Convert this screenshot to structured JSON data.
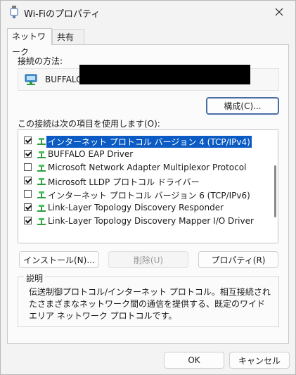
{
  "window": {
    "title": "Wi-Fiのプロパティ"
  },
  "tabs": [
    {
      "label": "ネットワーク"
    },
    {
      "label": "共有"
    }
  ],
  "connection": {
    "label": "接続の方法:",
    "adapter_name": "BUFFALO",
    "configure_label": "構成(C)..."
  },
  "items_section": {
    "label": "この接続は次の項目を使用します(O):",
    "items": [
      {
        "label": "インターネット プロトコル バージョン 4 (TCP/IPv4)",
        "checked": true,
        "selected": true
      },
      {
        "label": "BUFFALO EAP Driver",
        "checked": true,
        "selected": false
      },
      {
        "label": "Microsoft Network Adapter Multiplexor Protocol",
        "checked": false,
        "selected": false
      },
      {
        "label": "Microsoft LLDP プロトコル ドライバー",
        "checked": true,
        "selected": false
      },
      {
        "label": "インターネット プロトコル バージョン 6 (TCP/IPv6)",
        "checked": false,
        "selected": false
      },
      {
        "label": "Link-Layer Topology Discovery Responder",
        "checked": true,
        "selected": false
      },
      {
        "label": "Link-Layer Topology Discovery Mapper I/O Driver",
        "checked": true,
        "selected": false
      }
    ]
  },
  "actions": {
    "install_label": "インストール(N)...",
    "remove_label": "削除(U)",
    "properties_label": "プロパティ(R)"
  },
  "description": {
    "title": "説明",
    "text": "伝送制御プロトコル/インターネット プロトコル。相互接続されたさまざまなネットワーク間の通信を提供する、既定のワイド エリア ネットワーク プロトコルです。"
  },
  "footer": {
    "ok_label": "OK",
    "cancel_label": "キャンセル"
  },
  "colors": {
    "selection": "#0a5bc4",
    "primary_border": "#4a6fa5",
    "icon_green": "#2e9e3e"
  }
}
